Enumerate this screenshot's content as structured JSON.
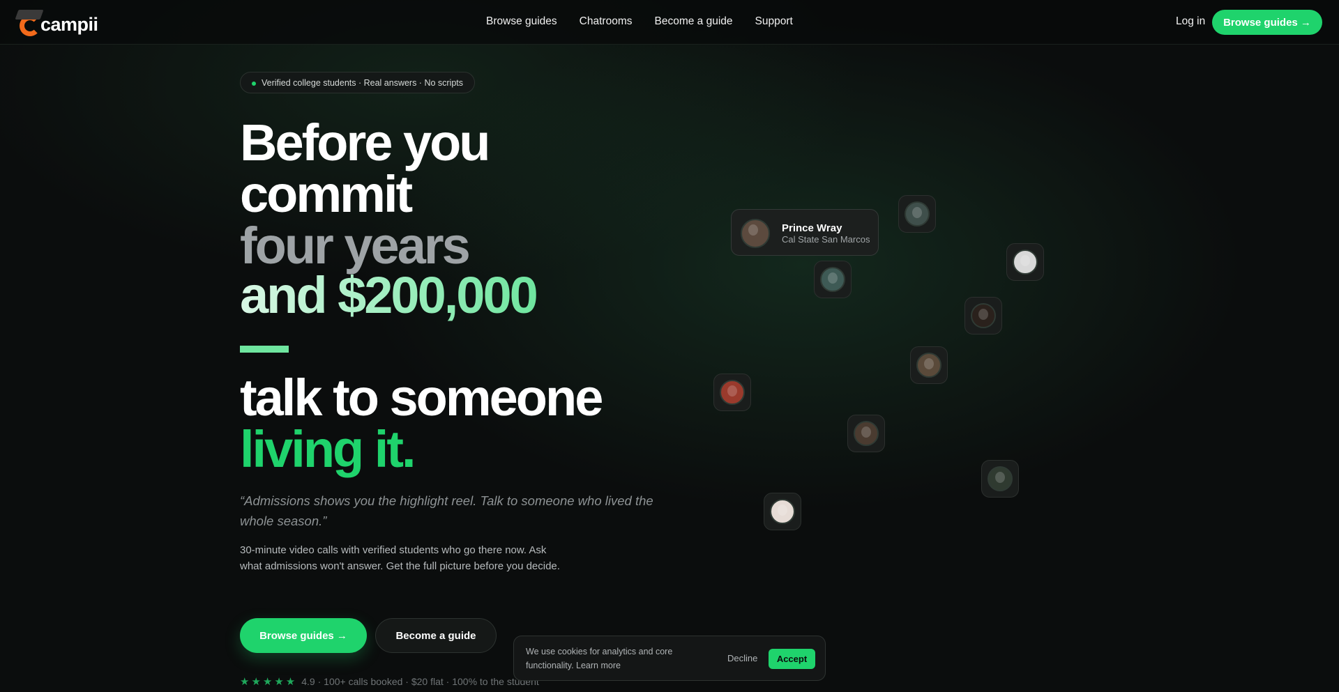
{
  "colors": {
    "accent_green": "#1fd36c",
    "logo_orange": "#f26a1b",
    "background": "#0b0d0d"
  },
  "nav": {
    "logo_text": "campii",
    "links": [
      "Browse guides",
      "Chatrooms",
      "Become a guide",
      "Support"
    ],
    "login": "Log in",
    "cta": "Browse guides →"
  },
  "hero": {
    "badge": "Verified college students · Real answers · No scripts",
    "headline": {
      "line1": "Before you",
      "line2": "commit",
      "line3": "four years",
      "line4": "and $200,000",
      "line5": "talk to someone",
      "line6": "living it."
    },
    "quote": "“Admissions shows you the highlight reel. Talk to someone who lived the whole season.”",
    "description": "30-minute video calls with verified students who go there now. Ask what admissions won't answer. Get the full picture before you decide.",
    "primary_button": "Browse guides →",
    "secondary_button": "Become a guide",
    "rating": {
      "stars": "★★★★★",
      "text": "4.9 · 100+ calls booked · $20 flat · 100% to the student"
    }
  },
  "profile_card": {
    "name": "Prince Wray",
    "school": "Cal State San Marcos"
  },
  "avatars": [
    {
      "name": "guide-avatar",
      "color": "#3f4f4b"
    },
    {
      "name": "guide-avatar",
      "color": "#d8d8d8"
    },
    {
      "name": "guide-avatar",
      "color": "#3e5a55"
    },
    {
      "name": "guide-avatar",
      "color": "#2a211c"
    },
    {
      "name": "guide-avatar",
      "color": "#5a4a3a"
    },
    {
      "name": "guide-avatar",
      "color": "#9a3a2c"
    },
    {
      "name": "guide-avatar",
      "color": "#4a3b30"
    },
    {
      "name": "guide-avatar",
      "color": "#2f3a30"
    },
    {
      "name": "guide-avatar",
      "color": "#e6dcd6"
    }
  ],
  "cookie": {
    "text": "We use cookies for analytics and core functionality. Learn more",
    "decline": "Decline",
    "accept": "Accept"
  }
}
